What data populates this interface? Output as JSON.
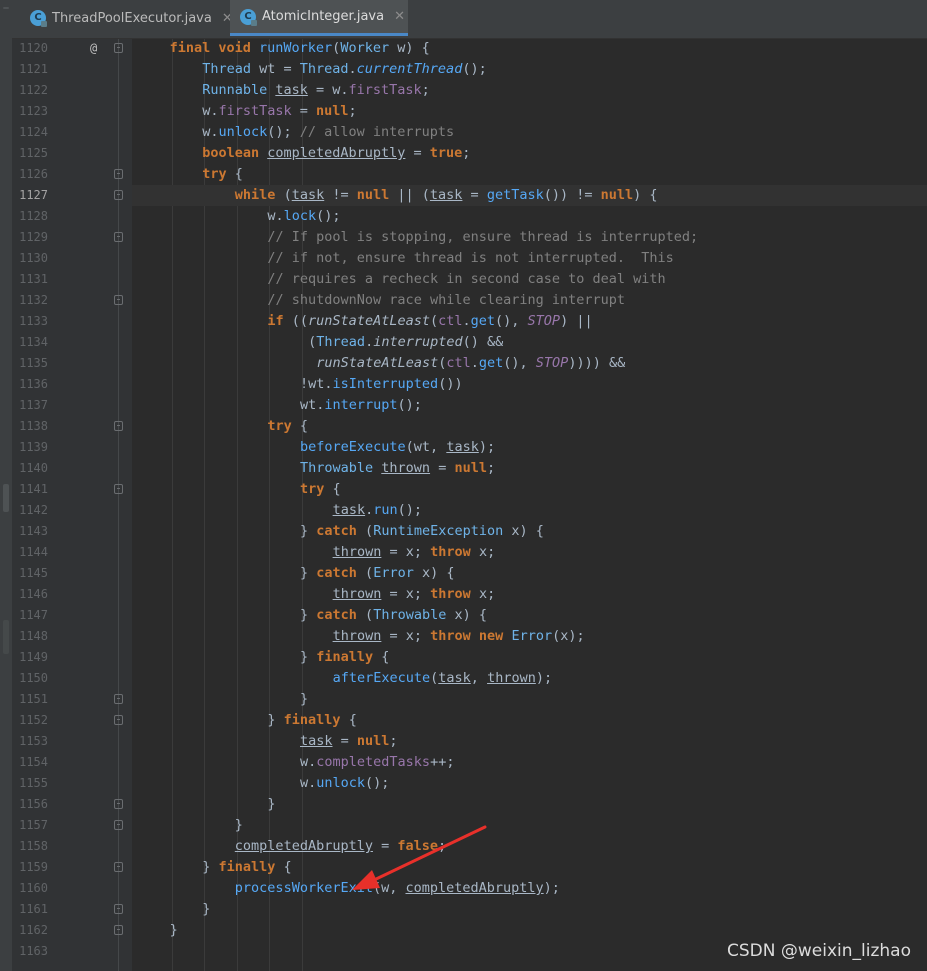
{
  "tabs": [
    {
      "label": "ThreadPoolExecutor.java",
      "active": false
    },
    {
      "label": "AtomicInteger.java",
      "active": true
    }
  ],
  "editor": {
    "current_line": "1127",
    "override_marker": "@",
    "lines": [
      {
        "n": "1120",
        "indent": 4,
        "tokens": [
          [
            "kw",
            "final "
          ],
          [
            "kw",
            "void "
          ],
          [
            "fn",
            "runWorker"
          ],
          [
            "pr",
            "("
          ],
          [
            "ty",
            "Worker "
          ],
          [
            "pr",
            "w) {"
          ]
        ]
      },
      {
        "n": "1121",
        "indent": 8,
        "tokens": [
          [
            "ty",
            "Thread "
          ],
          [
            "pr",
            "wt = "
          ],
          [
            "ty",
            "Thread"
          ],
          [
            "pr",
            "."
          ],
          [
            "fn it",
            "currentThread"
          ],
          [
            "pr",
            "();"
          ]
        ]
      },
      {
        "n": "1122",
        "indent": 8,
        "tokens": [
          [
            "ty",
            "Runnable "
          ],
          [
            "lv",
            "task"
          ],
          [
            "pr",
            " = w."
          ],
          [
            "fi",
            "firstTask"
          ],
          [
            "pr",
            ";"
          ]
        ]
      },
      {
        "n": "1123",
        "indent": 8,
        "tokens": [
          [
            "pr",
            "w."
          ],
          [
            "fi",
            "firstTask"
          ],
          [
            "pr",
            " = "
          ],
          [
            "kw",
            "null"
          ],
          [
            "pr",
            ";"
          ]
        ]
      },
      {
        "n": "1124",
        "indent": 8,
        "tokens": [
          [
            "pr",
            "w."
          ],
          [
            "fn",
            "unlock"
          ],
          [
            "pr",
            "(); "
          ],
          [
            "cm",
            "// allow interrupts"
          ]
        ]
      },
      {
        "n": "1125",
        "indent": 8,
        "tokens": [
          [
            "kw",
            "boolean "
          ],
          [
            "lv",
            "completedAbruptly"
          ],
          [
            "pr",
            " = "
          ],
          [
            "kw",
            "true"
          ],
          [
            "pr",
            ";"
          ]
        ]
      },
      {
        "n": "1126",
        "indent": 8,
        "tokens": [
          [
            "kw",
            "try "
          ],
          [
            "pr",
            "{"
          ]
        ]
      },
      {
        "n": "1127",
        "indent": 12,
        "tokens": [
          [
            "kw",
            "while "
          ],
          [
            "pr",
            "("
          ],
          [
            "lv",
            "task"
          ],
          [
            "pr",
            " != "
          ],
          [
            "kw",
            "null"
          ],
          [
            "pr",
            " || ("
          ],
          [
            "lv",
            "task"
          ],
          [
            "pr",
            " = "
          ],
          [
            "fn",
            "getTask"
          ],
          [
            "pr",
            "()) != "
          ],
          [
            "kw",
            "null"
          ],
          [
            "pr",
            ") {"
          ]
        ]
      },
      {
        "n": "1128",
        "indent": 16,
        "tokens": [
          [
            "pr",
            "w."
          ],
          [
            "fn",
            "lock"
          ],
          [
            "pr",
            "();"
          ]
        ]
      },
      {
        "n": "1129",
        "indent": 16,
        "tokens": [
          [
            "cm",
            "// If pool is stopping, ensure thread is interrupted;"
          ]
        ]
      },
      {
        "n": "1130",
        "indent": 16,
        "tokens": [
          [
            "cm",
            "// if not, ensure thread is not interrupted.  This"
          ]
        ]
      },
      {
        "n": "1131",
        "indent": 16,
        "tokens": [
          [
            "cm",
            "// requires a recheck in second case to deal with"
          ]
        ]
      },
      {
        "n": "1132",
        "indent": 16,
        "tokens": [
          [
            "cm",
            "// shutdownNow race while clearing interrupt"
          ]
        ]
      },
      {
        "n": "1133",
        "indent": 16,
        "tokens": [
          [
            "kw",
            "if "
          ],
          [
            "pr",
            "(("
          ],
          [
            "it",
            "runStateAtLeast"
          ],
          [
            "pr",
            "("
          ],
          [
            "fi",
            "ctl"
          ],
          [
            "pr",
            "."
          ],
          [
            "fn",
            "get"
          ],
          [
            "pr",
            "(), "
          ],
          [
            "fi it",
            "STOP"
          ],
          [
            "pr",
            ") ||"
          ]
        ]
      },
      {
        "n": "1134",
        "indent": 21,
        "tokens": [
          [
            "pr",
            "("
          ],
          [
            "ty",
            "Thread"
          ],
          [
            "pr",
            "."
          ],
          [
            "it",
            "interrupted"
          ],
          [
            "pr",
            "() &&"
          ]
        ]
      },
      {
        "n": "1135",
        "indent": 22,
        "tokens": [
          [
            "it",
            "runStateAtLeast"
          ],
          [
            "pr",
            "("
          ],
          [
            "fi",
            "ctl"
          ],
          [
            "pr",
            "."
          ],
          [
            "fn",
            "get"
          ],
          [
            "pr",
            "(), "
          ],
          [
            "fi it",
            "STOP"
          ],
          [
            "pr",
            ")))) &&"
          ]
        ]
      },
      {
        "n": "1136",
        "indent": 20,
        "tokens": [
          [
            "pr",
            "!wt."
          ],
          [
            "fn",
            "isInterrupted"
          ],
          [
            "pr",
            "())"
          ]
        ]
      },
      {
        "n": "1137",
        "indent": 20,
        "tokens": [
          [
            "pr",
            "wt."
          ],
          [
            "fn",
            "interrupt"
          ],
          [
            "pr",
            "();"
          ]
        ]
      },
      {
        "n": "1138",
        "indent": 16,
        "tokens": [
          [
            "kw",
            "try "
          ],
          [
            "pr",
            "{"
          ]
        ]
      },
      {
        "n": "1139",
        "indent": 20,
        "tokens": [
          [
            "fn",
            "beforeExecute"
          ],
          [
            "pr",
            "(wt, "
          ],
          [
            "lv",
            "task"
          ],
          [
            "pr",
            ");"
          ]
        ]
      },
      {
        "n": "1140",
        "indent": 20,
        "tokens": [
          [
            "ty",
            "Throwable "
          ],
          [
            "lv",
            "thrown"
          ],
          [
            "pr",
            " = "
          ],
          [
            "kw",
            "null"
          ],
          [
            "pr",
            ";"
          ]
        ]
      },
      {
        "n": "1141",
        "indent": 20,
        "tokens": [
          [
            "kw",
            "try "
          ],
          [
            "pr",
            "{"
          ]
        ]
      },
      {
        "n": "1142",
        "indent": 24,
        "tokens": [
          [
            "lv",
            "task"
          ],
          [
            "pr",
            "."
          ],
          [
            "fn",
            "run"
          ],
          [
            "pr",
            "();"
          ]
        ]
      },
      {
        "n": "1143",
        "indent": 20,
        "tokens": [
          [
            "pr",
            "} "
          ],
          [
            "kw",
            "catch "
          ],
          [
            "pr",
            "("
          ],
          [
            "ty",
            "RuntimeException "
          ],
          [
            "pr",
            "x) {"
          ]
        ]
      },
      {
        "n": "1144",
        "indent": 24,
        "tokens": [
          [
            "lv",
            "thrown"
          ],
          [
            "pr",
            " = x; "
          ],
          [
            "kw",
            "throw "
          ],
          [
            "pr",
            "x;"
          ]
        ]
      },
      {
        "n": "1145",
        "indent": 20,
        "tokens": [
          [
            "pr",
            "} "
          ],
          [
            "kw",
            "catch "
          ],
          [
            "pr",
            "("
          ],
          [
            "ty",
            "Error "
          ],
          [
            "pr",
            "x) {"
          ]
        ]
      },
      {
        "n": "1146",
        "indent": 24,
        "tokens": [
          [
            "lv",
            "thrown"
          ],
          [
            "pr",
            " = x; "
          ],
          [
            "kw",
            "throw "
          ],
          [
            "pr",
            "x;"
          ]
        ]
      },
      {
        "n": "1147",
        "indent": 20,
        "tokens": [
          [
            "pr",
            "} "
          ],
          [
            "kw",
            "catch "
          ],
          [
            "pr",
            "("
          ],
          [
            "ty",
            "Throwable "
          ],
          [
            "pr",
            "x) {"
          ]
        ]
      },
      {
        "n": "1148",
        "indent": 24,
        "tokens": [
          [
            "lv",
            "thrown"
          ],
          [
            "pr",
            " = x; "
          ],
          [
            "kw",
            "throw new "
          ],
          [
            "ty",
            "Error"
          ],
          [
            "pr",
            "(x);"
          ]
        ]
      },
      {
        "n": "1149",
        "indent": 20,
        "tokens": [
          [
            "pr",
            "} "
          ],
          [
            "kw",
            "finally "
          ],
          [
            "pr",
            "{"
          ]
        ]
      },
      {
        "n": "1150",
        "indent": 24,
        "tokens": [
          [
            "fn",
            "afterExecute"
          ],
          [
            "pr",
            "("
          ],
          [
            "lv",
            "task"
          ],
          [
            "pr",
            ", "
          ],
          [
            "lv",
            "thrown"
          ],
          [
            "pr",
            ");"
          ]
        ]
      },
      {
        "n": "1151",
        "indent": 20,
        "tokens": [
          [
            "pr",
            "}"
          ]
        ]
      },
      {
        "n": "1152",
        "indent": 16,
        "tokens": [
          [
            "pr",
            "} "
          ],
          [
            "kw",
            "finally "
          ],
          [
            "pr",
            "{"
          ]
        ]
      },
      {
        "n": "1153",
        "indent": 20,
        "tokens": [
          [
            "lv",
            "task"
          ],
          [
            "pr",
            " = "
          ],
          [
            "kw",
            "null"
          ],
          [
            "pr",
            ";"
          ]
        ]
      },
      {
        "n": "1154",
        "indent": 20,
        "tokens": [
          [
            "pr",
            "w."
          ],
          [
            "fi",
            "completedTasks"
          ],
          [
            "pr",
            "++;"
          ]
        ]
      },
      {
        "n": "1155",
        "indent": 20,
        "tokens": [
          [
            "pr",
            "w."
          ],
          [
            "fn",
            "unlock"
          ],
          [
            "pr",
            "();"
          ]
        ]
      },
      {
        "n": "1156",
        "indent": 16,
        "tokens": [
          [
            "pr",
            "}"
          ]
        ]
      },
      {
        "n": "1157",
        "indent": 12,
        "tokens": [
          [
            "pr",
            "}"
          ]
        ]
      },
      {
        "n": "1158",
        "indent": 12,
        "tokens": [
          [
            "lv",
            "completedAbruptly"
          ],
          [
            "pr",
            " = "
          ],
          [
            "kw",
            "false"
          ],
          [
            "pr",
            ";"
          ]
        ]
      },
      {
        "n": "1159",
        "indent": 8,
        "tokens": [
          [
            "pr",
            "} "
          ],
          [
            "kw",
            "finally "
          ],
          [
            "pr",
            "{"
          ]
        ]
      },
      {
        "n": "1160",
        "indent": 12,
        "tokens": [
          [
            "fn",
            "processWorkerExit"
          ],
          [
            "pr",
            "(w, "
          ],
          [
            "lv",
            "completedAbruptly"
          ],
          [
            "pr",
            ");"
          ]
        ]
      },
      {
        "n": "1161",
        "indent": 8,
        "tokens": [
          [
            "pr",
            "}"
          ]
        ]
      },
      {
        "n": "1162",
        "indent": 4,
        "tokens": [
          [
            "pr",
            "}"
          ]
        ]
      },
      {
        "n": "1163",
        "indent": 0,
        "tokens": []
      }
    ]
  },
  "watermark": "CSDN @weixin_lizhao",
  "colors": {
    "background": "#2b2b2b",
    "keyword": "#cc7832",
    "field": "#9876aa",
    "comment": "#808080",
    "annotation_arrow": "#e8302a"
  }
}
